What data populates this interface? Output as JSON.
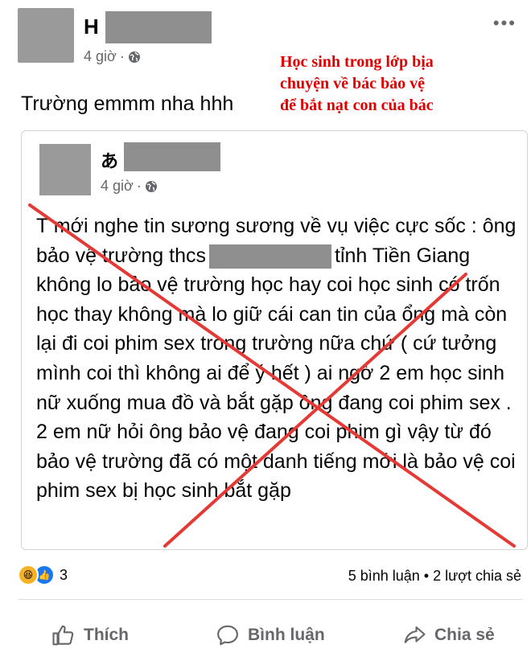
{
  "post": {
    "author_initial": "H",
    "time": "4 giờ",
    "text": "Trường emmm nha hhh",
    "more": "•••"
  },
  "caption": {
    "line1": "Học sinh trong lớp bịa",
    "line2": "chuyện về bác bảo vệ",
    "line3": "để bắt nạt con của bác"
  },
  "shared": {
    "author_initial": "あ",
    "time": "4 giờ",
    "body_part1": "T mới nghe tin sương sương về vụ việc cực sốc : ông bảo vệ trường thcs",
    "body_part2": "tỉnh Tiền Giang không lo bảo vệ trường học hay coi học sinh có trốn học thay không mà lo giữ cái can tin của ổng mà còn lại đi coi phim sex trong trường nữa chứ ( cứ tưởng mình coi thì không ai để ý hết ) ai ngờ 2 em học sinh nữ xuống mua đồ và bắt gặp ông đang coi phim sex . 2 em nữ hỏi ông bảo vệ đang coi phim gì vậy từ đó bảo vệ trường đã có một danh tiếng mới là bảo vệ coi phim sex bị học sinh bắt gặp"
  },
  "reactions": {
    "count": "3",
    "stats": "5 bình luận • 2 lượt chia sẻ"
  },
  "actions": {
    "like": "Thích",
    "comment": "Bình luận",
    "share": "Chia sẻ"
  },
  "colors": {
    "caption": "#e00000",
    "cross": "#e53935",
    "meta": "#65676b",
    "like_blue": "#1877f2",
    "haha_yellow": "#f7b125"
  }
}
